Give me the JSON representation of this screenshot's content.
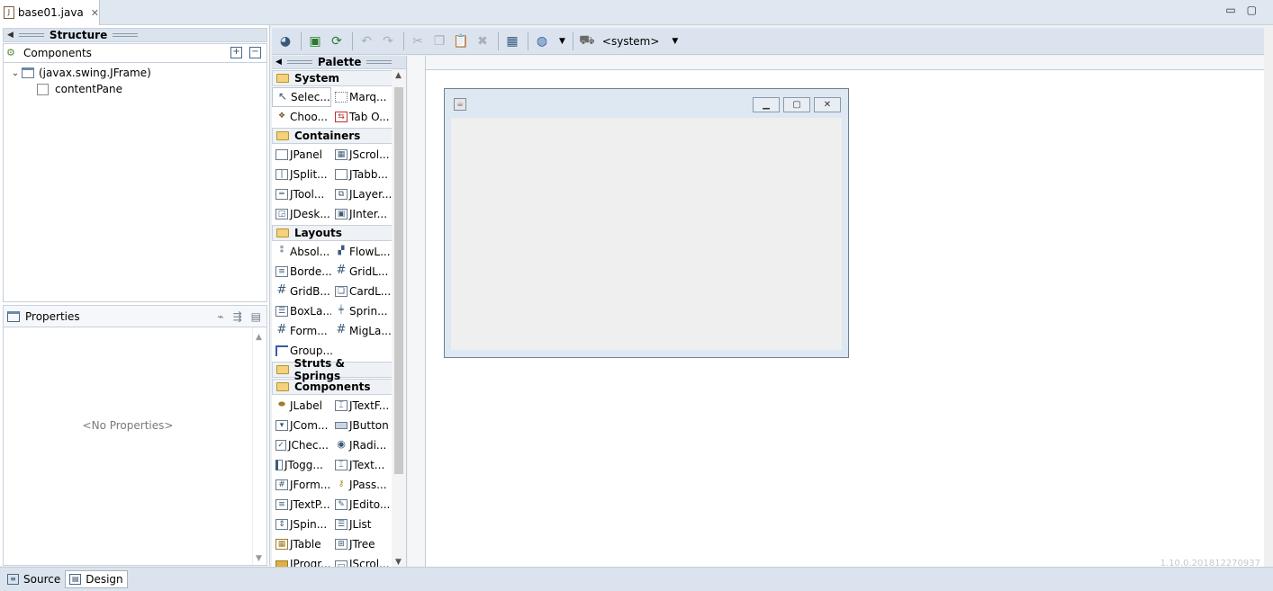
{
  "editor": {
    "tab_label": "base01.java",
    "close_glyph": "✕",
    "minimize_glyph": "▭",
    "maximize_glyph": "▢"
  },
  "structure": {
    "title": "Structure",
    "components_label": "Components",
    "tree": [
      {
        "label": "(javax.swing.JFrame)",
        "expanded": true
      },
      {
        "label": "contentPane"
      }
    ],
    "properties_label": "Properties",
    "no_properties": "<No Properties>"
  },
  "toolbar": {
    "system_label": "<system>"
  },
  "palette": {
    "title": "Palette",
    "categories": {
      "system": {
        "label": "System",
        "items": [
          "Selec...",
          "Marq...",
          "Choo...",
          "Tab O..."
        ]
      },
      "containers": {
        "label": "Containers",
        "items": [
          "JPanel",
          "JScrol...",
          "JSplit...",
          "JTabb...",
          "JTool...",
          "JLayer...",
          "JDesk...",
          "JInter..."
        ]
      },
      "layouts": {
        "label": "Layouts",
        "items": [
          "Absol...",
          "FlowL...",
          "Borde...",
          "GridL...",
          "GridB...",
          "CardL...",
          "BoxLa...",
          "Sprin...",
          "Form...",
          "MigLa...",
          "Group..."
        ]
      },
      "struts": {
        "label": "Struts & Springs"
      },
      "components": {
        "label": "Components",
        "items": [
          "JLabel",
          "JTextF...",
          "JCom...",
          "JButton",
          "JChec...",
          "JRadi...",
          "JTogg...",
          "JText...",
          "JForm...",
          "JPass...",
          "JTextP...",
          "JEdito...",
          "JSpin...",
          "JList",
          "JTable",
          "JTree",
          "JProgr...",
          "JScrol..."
        ]
      }
    }
  },
  "design": {
    "version_text": "1.10.0.201812270937"
  },
  "bottom_tabs": {
    "source_label": "Source",
    "design_label": "Design"
  }
}
